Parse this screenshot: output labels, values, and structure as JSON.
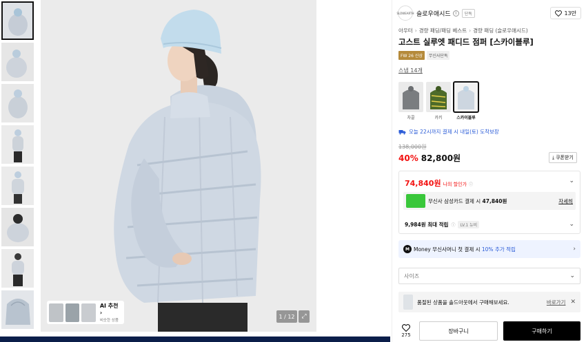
{
  "gallery": {
    "thumbnails": [
      {
        "alt": "thumbnail-1"
      },
      {
        "alt": "thumbnail-2"
      },
      {
        "alt": "thumbnail-3"
      },
      {
        "alt": "thumbnail-4"
      },
      {
        "alt": "thumbnail-5"
      },
      {
        "alt": "thumbnail-6"
      },
      {
        "alt": "thumbnail-7"
      },
      {
        "alt": "thumbnail-8"
      }
    ],
    "ai_title": "AI 추천 ›",
    "ai_subtitle": "비슷한 상품",
    "counter": "1 / 12",
    "expand_icon": "⤢"
  },
  "brand": {
    "logo_text": "SLOWEARTH",
    "name": "슬로우애시드",
    "info_icon": "i",
    "badge": "단독",
    "likes": "13만"
  },
  "breadcrumb": [
    "아우터",
    "경량 패딩/패딩 베스트",
    "경량 패딩 (슬로우애시드)"
  ],
  "product": {
    "title": "고스트 실루엣 패디드 점퍼 [스카이블루]",
    "season_badge": "FW 26 신상",
    "exclusive_badge": "무신사단독",
    "review_link": "스냅 14개"
  },
  "colors": {
    "options": [
      {
        "label": "차콜"
      },
      {
        "label": "카키"
      },
      {
        "label": "스카이블루"
      }
    ]
  },
  "delivery": {
    "text": "오늘 22시까지 결제 시 내일(토) 도착보장"
  },
  "price": {
    "original": "138,000원",
    "discount": "40%",
    "sale": "82,800원",
    "coupon_label": "쿠폰받기"
  },
  "benefits": {
    "my_price": "74,840원",
    "my_price_label": "나의 할인가",
    "info_icon": "ⓘ",
    "card_text": "무신사 삼성카드 결제 시",
    "card_price": "47,840원",
    "card_detail": "자세히",
    "points_text": "9,984원 최대 적립",
    "points_info": "ⓘ",
    "level_badge": "LV.1 뉴비"
  },
  "money": {
    "icon": "M",
    "prefix": "Money 무신사머니 첫 결제 시 ",
    "highlight": "10% 추가 적립"
  },
  "size_select": {
    "placeholder": "사이즈"
  },
  "restock": {
    "text": "품절된 상품을 솔드아웃에서 구매해보세요.",
    "link": "바로가기",
    "close": "✕"
  },
  "actions": {
    "heart_count": "275",
    "cart_label": "장바구니",
    "buy_label": "구매하기"
  },
  "theme": {
    "accent_red": "#f31110",
    "accent_blue": "#2a5bd7",
    "dark_bar": "#0b1e4a"
  }
}
